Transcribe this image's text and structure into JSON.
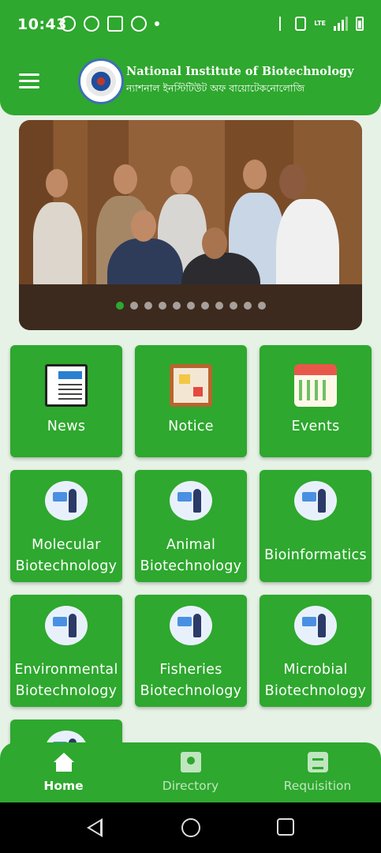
{
  "status_bar": {
    "time": "10:43",
    "left_icons": [
      "whatsapp-icon",
      "messenger-icon",
      "tiktok-icon",
      "alarm-icon",
      "dot"
    ],
    "right_icons": [
      "bluetooth-icon",
      "vibrate-icon",
      "volte-icon",
      "lte-signal-icon",
      "signal-icon",
      "battery-icon"
    ],
    "network_label": "LTE"
  },
  "header": {
    "title_en": "National Institute of Biotechnology",
    "title_bn": "ন্যাশনাল ইনস্টিটিউট অফ বায়োটেকনোলোজি",
    "menu_icon": "hamburger-menu-icon"
  },
  "banner": {
    "slides_count": 11,
    "active_slide": 1
  },
  "grid": [
    {
      "label_lines": [
        "News"
      ],
      "icon": "newspaper-icon"
    },
    {
      "label_lines": [
        "Notice"
      ],
      "icon": "notice-board-icon"
    },
    {
      "label_lines": [
        "Events"
      ],
      "icon": "calendar-icon"
    },
    {
      "label_lines": [
        "Molecular",
        "Biotechnology"
      ],
      "icon": "scientist-laptop-icon"
    },
    {
      "label_lines": [
        "Animal",
        "Biotechnology"
      ],
      "icon": "scientist-laptop-icon"
    },
    {
      "label_lines": [
        "Bioinformatics"
      ],
      "icon": "scientist-laptop-icon"
    },
    {
      "label_lines": [
        "Environmental",
        "Biotechnology"
      ],
      "icon": "scientist-laptop-icon"
    },
    {
      "label_lines": [
        "Fisheries",
        "Biotechnology"
      ],
      "icon": "scientist-laptop-icon"
    },
    {
      "label_lines": [
        "Microbial",
        "Biotechnology"
      ],
      "icon": "scientist-laptop-icon"
    },
    {
      "label_lines": [],
      "icon": "scientist-laptop-icon"
    }
  ],
  "bottom_nav": [
    {
      "label": "Home",
      "icon": "home-icon",
      "active": true
    },
    {
      "label": "Directory",
      "icon": "directory-icon",
      "active": false
    },
    {
      "label": "Requisition",
      "icon": "requisition-icon",
      "active": false
    }
  ],
  "colors": {
    "primary": "#2ea82e",
    "background": "#e6f2e6",
    "nav_inactive": "#bfe6bf"
  }
}
